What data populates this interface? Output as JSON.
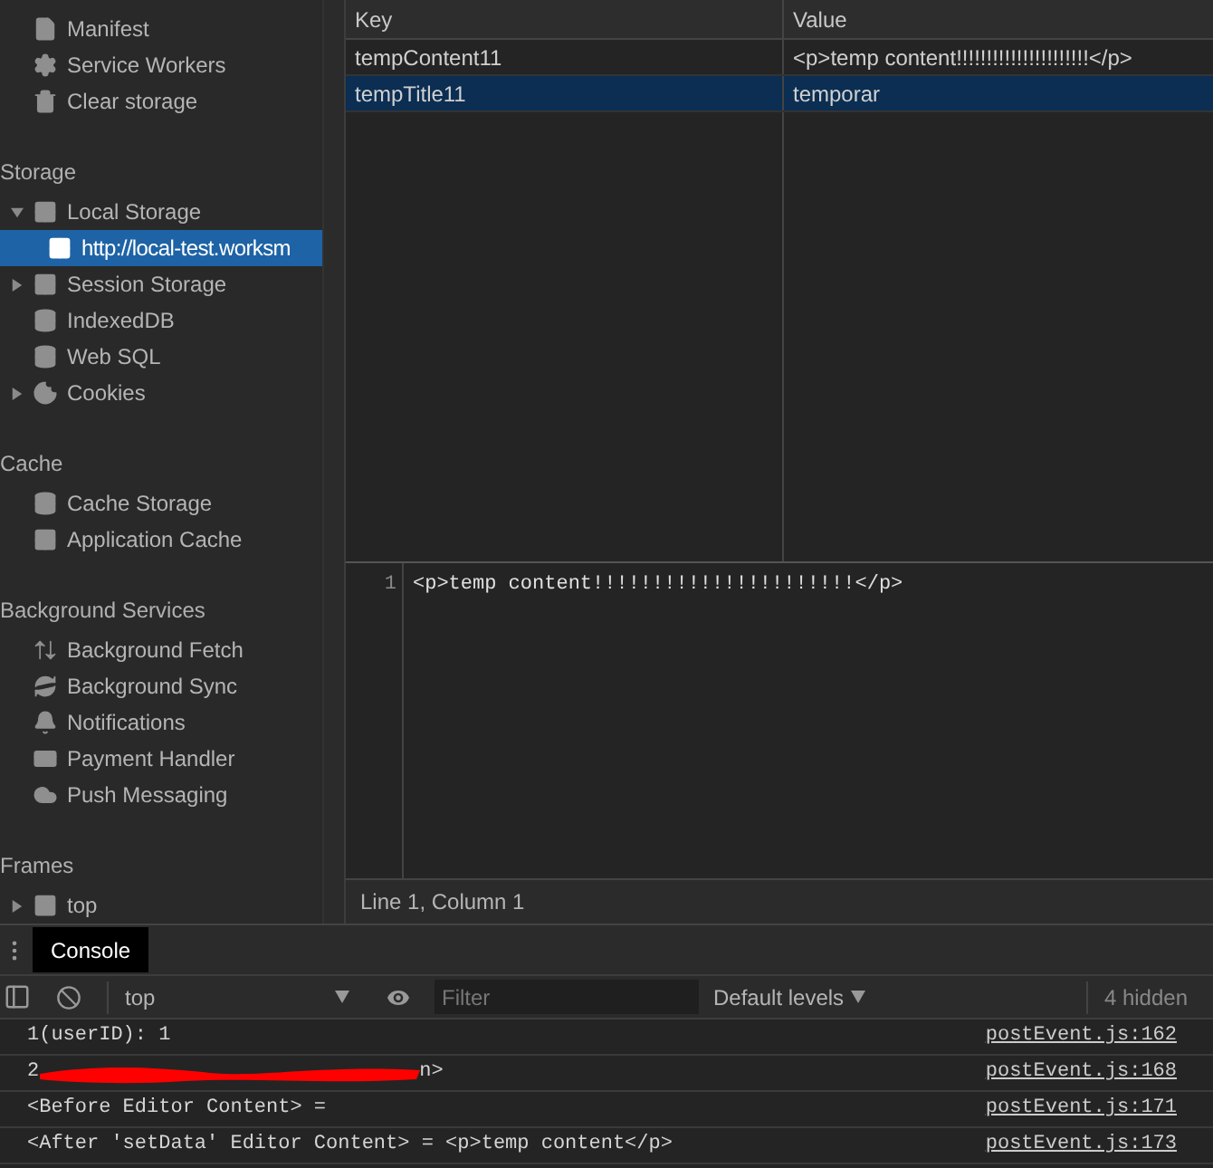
{
  "sidebar": {
    "sections": [
      {
        "items": [
          {
            "label": "Manifest",
            "selected": false
          },
          {
            "label": "Service Workers",
            "selected": false
          },
          {
            "label": "Clear storage",
            "selected": false
          }
        ]
      },
      {
        "title": "Storage",
        "items": [
          {
            "label": "Local Storage",
            "selected": false,
            "expanded": true,
            "children": [
              {
                "label": "http://local-test.worksm",
                "selected": true
              }
            ]
          },
          {
            "label": "Session Storage",
            "selected": false,
            "expanded": false
          },
          {
            "label": "IndexedDB",
            "selected": false
          },
          {
            "label": "Web SQL",
            "selected": false
          },
          {
            "label": "Cookies",
            "selected": false,
            "expanded": false
          }
        ]
      },
      {
        "title": "Cache",
        "items": [
          {
            "label": "Cache Storage",
            "selected": false
          },
          {
            "label": "Application Cache",
            "selected": false
          }
        ]
      },
      {
        "title": "Background Services",
        "items": [
          {
            "label": "Background Fetch",
            "selected": false
          },
          {
            "label": "Background Sync",
            "selected": false
          },
          {
            "label": "Notifications",
            "selected": false
          },
          {
            "label": "Payment Handler",
            "selected": false
          },
          {
            "label": "Push Messaging",
            "selected": false
          }
        ]
      },
      {
        "title": "Frames",
        "items": [
          {
            "label": "top",
            "selected": false,
            "expanded": false
          }
        ]
      }
    ]
  },
  "table": {
    "columns": [
      "Key",
      "Value"
    ],
    "rows": [
      {
        "key": "tempContent11",
        "value": "<p>temp content!!!!!!!!!!!!!!!!!!!!!!</p>",
        "selected": false
      },
      {
        "key": "tempTitle11",
        "value": "temporar",
        "selected": true
      }
    ]
  },
  "editor": {
    "line_number": "1",
    "text": "<p>temp content!!!!!!!!!!!!!!!!!!!!!!</p>",
    "status": "Line 1, Column 1"
  },
  "drawer": {
    "tabs": [
      {
        "label": "Console",
        "selected": true
      }
    ],
    "toolbar": {
      "context": "top",
      "filter_placeholder": "Filter",
      "levels": "Default levels",
      "hidden_count": "4 hidden"
    },
    "messages": [
      {
        "kind": "plain",
        "text": "1(userID): 1",
        "source": "postEvent.js:162"
      },
      {
        "kind": "redacted",
        "lead": "2",
        "tail": "n>",
        "source": "postEvent.js:168"
      },
      {
        "kind": "plain",
        "text": "<Before Editor Content> =",
        "source": "postEvent.js:171"
      },
      {
        "kind": "plain",
        "text": "<After 'setData' Editor Content> = <p>temp content</p>",
        "source": "postEvent.js:173"
      }
    ]
  }
}
